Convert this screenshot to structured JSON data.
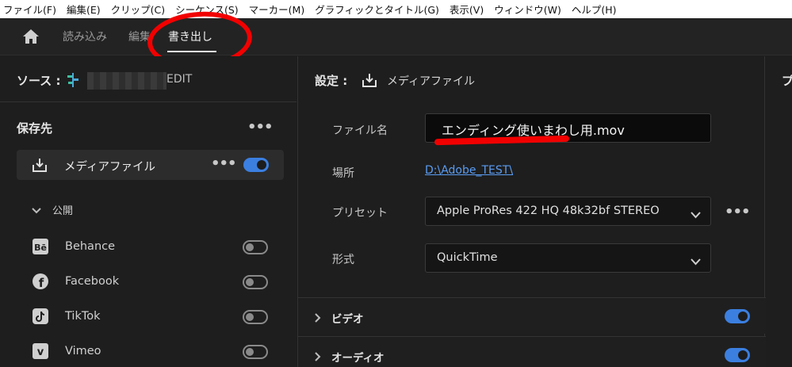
{
  "menu": [
    "ファイル(F)",
    "編集(E)",
    "クリップ(C)",
    "シーケンス(S)",
    "マーカー(M)",
    "グラフィックとタイトル(G)",
    "表示(V)",
    "ウィンドウ(W)",
    "ヘルプ(H)"
  ],
  "nav": {
    "import": "読み込み",
    "edit": "編集",
    "export": "書き出し"
  },
  "source": {
    "label": "ソース :",
    "name": "EDIT"
  },
  "destinations": {
    "title": "保存先",
    "more": "•••",
    "media": {
      "label": "メディアファイル",
      "more": "•••",
      "enabled": true
    },
    "publish_label": "公開",
    "social": [
      {
        "name": "Behance",
        "icon": "behance-icon",
        "enabled": false
      },
      {
        "name": "Facebook",
        "icon": "facebook-icon",
        "enabled": false
      },
      {
        "name": "TikTok",
        "icon": "tiktok-icon",
        "enabled": false
      },
      {
        "name": "Vimeo",
        "icon": "vimeo-icon",
        "enabled": false
      }
    ]
  },
  "settings": {
    "label": "設定 :",
    "target": "メディアファイル",
    "filename_label": "ファイル名",
    "filename": "エンディング使いまわし用.mov",
    "location_label": "場所",
    "location": "D:\\Adobe_TEST\\",
    "preset_label": "プリセット",
    "preset": "Apple ProRes 422 HQ 48k32bf STEREO",
    "preset_more": "•••",
    "format_label": "形式",
    "format": "QuickTime",
    "video_label": "ビデオ",
    "audio_label": "オーディオ"
  },
  "right_panel": {
    "label_fragment": "プ"
  },
  "colors": {
    "accent": "#3b7fe0",
    "annotation": "#f20000",
    "link": "#5a9cf2"
  }
}
